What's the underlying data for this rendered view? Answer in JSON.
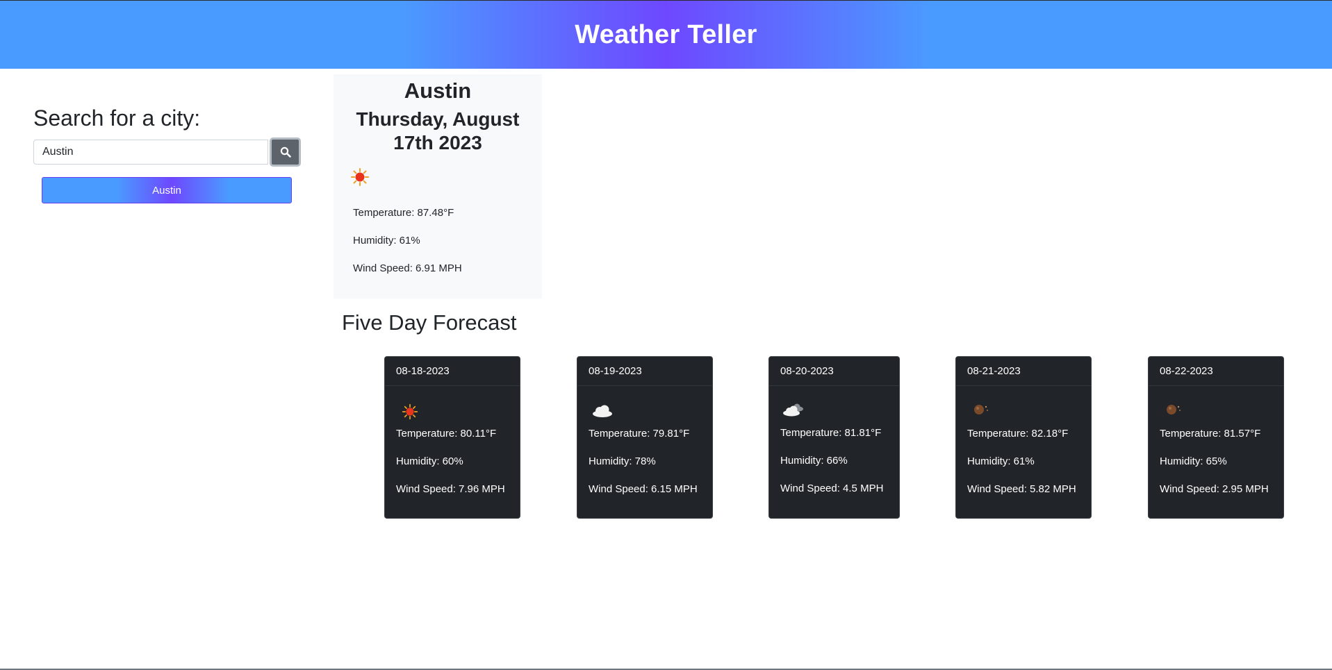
{
  "header": {
    "title": "Weather Teller"
  },
  "search": {
    "label": "Search for a city:",
    "value": "Austin",
    "button_icon": "search-icon"
  },
  "history": [
    {
      "label": "Austin"
    }
  ],
  "today": {
    "city": "Austin",
    "date": "Thursday, August 17th 2023",
    "icon": "sunny-icon",
    "temperature": "Temperature: 87.48°F",
    "humidity": "Humidity: 61%",
    "wind": "Wind Speed: 6.91 MPH"
  },
  "forecast": {
    "title": "Five Day Forecast",
    "days": [
      {
        "date": "08-18-2023",
        "icon": "sunny-icon",
        "temperature": "Temperature: 80.11°F",
        "humidity": "Humidity: 60%",
        "wind": "Wind Speed: 7.96 MPH"
      },
      {
        "date": "08-19-2023",
        "icon": "cloud-icon",
        "temperature": "Temperature: 79.81°F",
        "humidity": "Humidity: 78%",
        "wind": "Wind Speed: 6.15 MPH"
      },
      {
        "date": "08-20-2023",
        "icon": "broken-clouds-icon",
        "temperature": "Temperature: 81.81°F",
        "humidity": "Humidity: 66%",
        "wind": "Wind Speed: 4.5 MPH"
      },
      {
        "date": "08-21-2023",
        "icon": "night-clear-icon",
        "temperature": "Temperature: 82.18°F",
        "humidity": "Humidity: 61%",
        "wind": "Wind Speed: 5.82 MPH"
      },
      {
        "date": "08-22-2023",
        "icon": "night-clear-icon",
        "temperature": "Temperature: 81.57°F",
        "humidity": "Humidity: 65%",
        "wind": "Wind Speed: 2.95 MPH"
      }
    ]
  },
  "colors": {
    "header_blue": "#4a9bff",
    "header_purple": "#6e48ff",
    "card_dark": "#212529",
    "today_bg": "#f8f9fa"
  }
}
